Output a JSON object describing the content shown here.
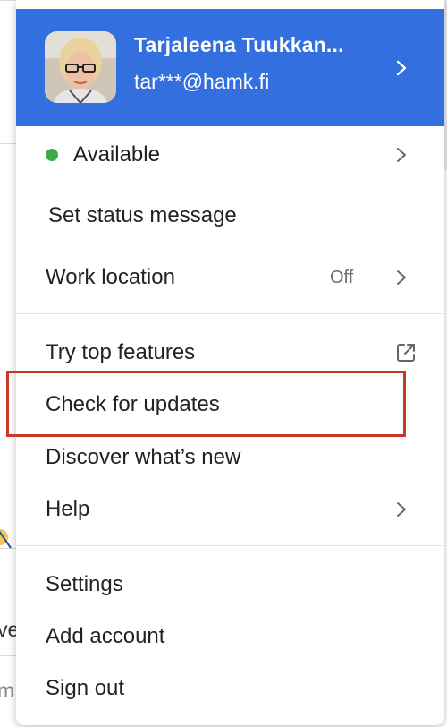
{
  "profile": {
    "name": "Tarjaleena Tuukkan...",
    "email": "tar***@hamk.fi",
    "header_color": "#336fde"
  },
  "menu": {
    "status": {
      "label": "Available",
      "color": "#3cab4b"
    },
    "set_status": "Set status message",
    "work_location": {
      "label": "Work location",
      "value": "Off"
    },
    "try_top_features": "Try top features",
    "check_updates": "Check for updates",
    "discover": "Discover what’s new",
    "help": "Help",
    "settings": "Settings",
    "add_account": "Add account",
    "sign_out": "Sign out"
  },
  "background": {
    "fragment_1": "ve",
    "fragment_2": "m"
  },
  "highlight_color": "#c8392a"
}
